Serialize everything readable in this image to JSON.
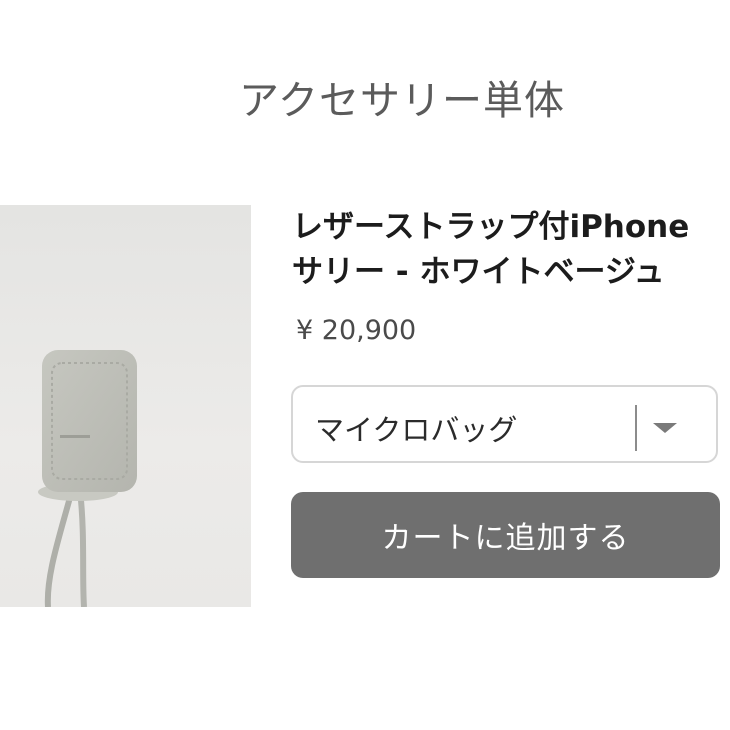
{
  "section": {
    "title": "アクセサリー単体"
  },
  "product": {
    "name": "レザーストラップ付iPhone\nサリー - ホワイトベージュ",
    "price": "¥ 20,900",
    "image_colors": {
      "background": "#e6e6e4",
      "pouch": "#bcbdb6",
      "strap": "#aeafa9"
    }
  },
  "variant": {
    "selected": "マイクロバッグ",
    "icon": "chevron-down-icon"
  },
  "cart": {
    "button_label": "カートに追加する",
    "color": "#6f6f6f"
  }
}
